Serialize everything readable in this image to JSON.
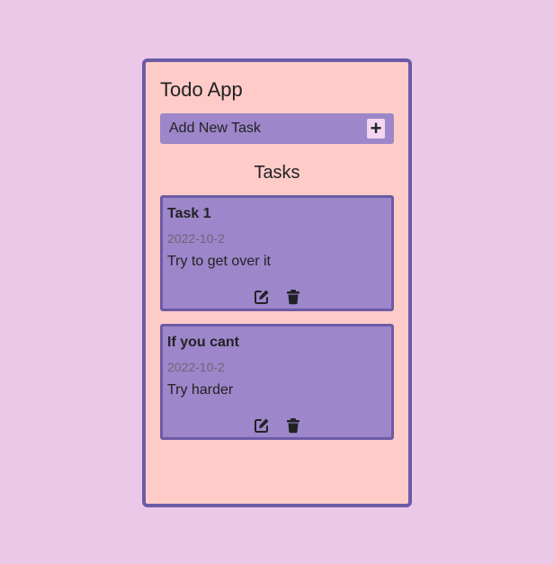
{
  "app": {
    "title": "Todo App",
    "add_task_label": "Add New Task",
    "add_icon": "plus-icon",
    "tasks_heading": "Tasks"
  },
  "tasks": [
    {
      "title": "Task 1",
      "date": "2022-10-2",
      "description": "Try to get over it",
      "edit_icon": "edit-icon",
      "delete_icon": "trash-icon"
    },
    {
      "title": "If you cant",
      "date": "2022-10-2",
      "description": "Try harder",
      "edit_icon": "edit-icon",
      "delete_icon": "trash-icon"
    }
  ],
  "colors": {
    "page_background": "#ecc8e8",
    "app_background": "#ffcbc8",
    "border": "#6b5ba6",
    "card_background": "#9d86c9",
    "date_text": "#6e6678"
  }
}
